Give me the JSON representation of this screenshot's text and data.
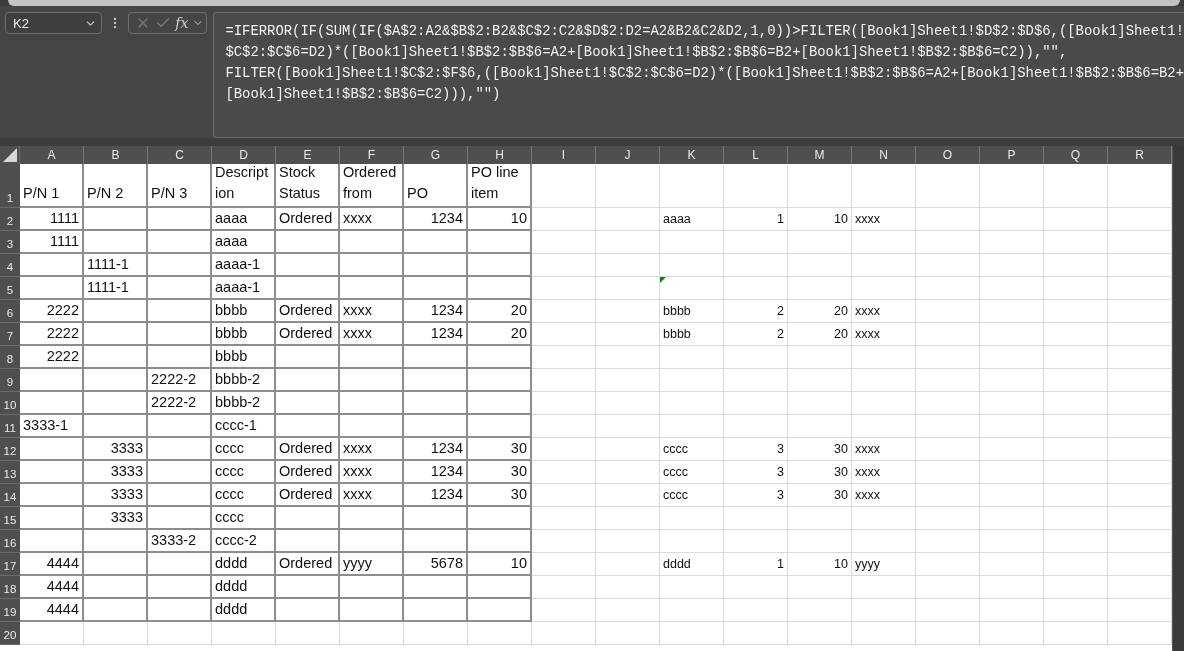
{
  "formula_bar": {
    "name_box": "K2",
    "function_label": "fx",
    "formula_lines": [
      "=IFERROR(IF(SUM(IF($A$2:A2&$B$2:B2&$C$2:C2&$D$2:D2=A2&B2&C2&D2,1,0))>FILTER([Book1]Sheet1!$D$2:$D$6,([Book1]Sheet1!",
      "$C$2:$C$6=D2)*([Book1]Sheet1!$B$2:$B$6=A2+[Book1]Sheet1!$B$2:$B$6=B2+[Book1]Sheet1!$B$2:$B$6=C2)),\"\",",
      "FILTER([Book1]Sheet1!$C$2:$F$6,([Book1]Sheet1!$C$2:$C$6=D2)*([Book1]Sheet1!$B$2:$B$6=A2+[Book1]Sheet1!$B$2:$B$6=B2+",
      "[Book1]Sheet1!$B$2:$B$6=C2))),\"\")"
    ]
  },
  "columns": [
    {
      "letter": "A",
      "bordered": true
    },
    {
      "letter": "B",
      "bordered": true
    },
    {
      "letter": "C",
      "bordered": true
    },
    {
      "letter": "D",
      "bordered": true
    },
    {
      "letter": "E",
      "bordered": true
    },
    {
      "letter": "F",
      "bordered": true
    },
    {
      "letter": "G",
      "bordered": true
    },
    {
      "letter": "H",
      "bordered": true
    },
    {
      "letter": "I",
      "bordered": false
    },
    {
      "letter": "J",
      "bordered": false
    },
    {
      "letter": "K",
      "bordered": false
    },
    {
      "letter": "L",
      "bordered": false
    },
    {
      "letter": "M",
      "bordered": false
    },
    {
      "letter": "N",
      "bordered": false
    },
    {
      "letter": "O",
      "bordered": false
    },
    {
      "letter": "P",
      "bordered": false
    },
    {
      "letter": "Q",
      "bordered": false
    },
    {
      "letter": "R",
      "bordered": false
    }
  ],
  "rows": [
    {
      "number": "1",
      "bordered": true,
      "cells": {
        "A": {
          "text": "P/N 1",
          "kind": "text"
        },
        "B": {
          "text": "P/N 2",
          "kind": "text"
        },
        "C": {
          "text": "P/N 3",
          "kind": "text"
        },
        "D": {
          "text": "Description",
          "kind": "text"
        },
        "E": {
          "text": "Stock Status",
          "kind": "text"
        },
        "F": {
          "text": "Ordered from",
          "kind": "text"
        },
        "G": {
          "text": "PO",
          "kind": "text"
        },
        "H": {
          "text": "PO line item",
          "kind": "text"
        }
      }
    },
    {
      "number": "2",
      "bordered": true,
      "cells": {
        "A": {
          "text": "1111",
          "kind": "number"
        },
        "D": {
          "text": "aaaa",
          "kind": "text"
        },
        "E": {
          "text": "Ordered",
          "kind": "text"
        },
        "F": {
          "text": "xxxx",
          "kind": "text"
        },
        "G": {
          "text": "1234",
          "kind": "number"
        },
        "H": {
          "text": "10",
          "kind": "number"
        },
        "K": {
          "text": "aaaa",
          "kind": "text"
        },
        "L": {
          "text": "1",
          "kind": "number"
        },
        "M": {
          "text": "10",
          "kind": "number"
        },
        "N": {
          "text": "xxxx",
          "kind": "text"
        }
      }
    },
    {
      "number": "3",
      "bordered": true,
      "cells": {
        "A": {
          "text": "1111",
          "kind": "number"
        },
        "D": {
          "text": "aaaa",
          "kind": "text"
        }
      }
    },
    {
      "number": "4",
      "bordered": true,
      "cells": {
        "B": {
          "text": "1111-1",
          "kind": "text"
        },
        "D": {
          "text": "aaaa-1",
          "kind": "text"
        }
      }
    },
    {
      "number": "5",
      "bordered": true,
      "cells": {
        "B": {
          "text": "1111-1",
          "kind": "text"
        },
        "D": {
          "text": "aaaa-1",
          "kind": "text"
        },
        "K": {
          "error_flag": true
        }
      }
    },
    {
      "number": "6",
      "bordered": true,
      "cells": {
        "A": {
          "text": "2222",
          "kind": "number"
        },
        "D": {
          "text": "bbbb",
          "kind": "text"
        },
        "E": {
          "text": "Ordered",
          "kind": "text"
        },
        "F": {
          "text": "xxxx",
          "kind": "text"
        },
        "G": {
          "text": "1234",
          "kind": "number"
        },
        "H": {
          "text": "20",
          "kind": "number"
        },
        "K": {
          "text": "bbbb",
          "kind": "text"
        },
        "L": {
          "text": "2",
          "kind": "number"
        },
        "M": {
          "text": "20",
          "kind": "number"
        },
        "N": {
          "text": "xxxx",
          "kind": "text"
        }
      }
    },
    {
      "number": "7",
      "bordered": true,
      "cells": {
        "A": {
          "text": "2222",
          "kind": "number"
        },
        "D": {
          "text": "bbbb",
          "kind": "text"
        },
        "E": {
          "text": "Ordered",
          "kind": "text"
        },
        "F": {
          "text": "xxxx",
          "kind": "text"
        },
        "G": {
          "text": "1234",
          "kind": "number"
        },
        "H": {
          "text": "20",
          "kind": "number"
        },
        "K": {
          "text": "bbbb",
          "kind": "text"
        },
        "L": {
          "text": "2",
          "kind": "number"
        },
        "M": {
          "text": "20",
          "kind": "number"
        },
        "N": {
          "text": "xxxx",
          "kind": "text"
        }
      }
    },
    {
      "number": "8",
      "bordered": true,
      "cells": {
        "A": {
          "text": "2222",
          "kind": "number"
        },
        "D": {
          "text": "bbbb",
          "kind": "text"
        }
      }
    },
    {
      "number": "9",
      "bordered": true,
      "cells": {
        "C": {
          "text": "2222-2",
          "kind": "text"
        },
        "D": {
          "text": "bbbb-2",
          "kind": "text"
        }
      }
    },
    {
      "number": "10",
      "bordered": true,
      "cells": {
        "C": {
          "text": "2222-2",
          "kind": "text"
        },
        "D": {
          "text": "bbbb-2",
          "kind": "text"
        }
      }
    },
    {
      "number": "11",
      "bordered": true,
      "cells": {
        "A": {
          "text": "3333-1",
          "kind": "text"
        },
        "D": {
          "text": "cccc-1",
          "kind": "text"
        }
      }
    },
    {
      "number": "12",
      "bordered": true,
      "cells": {
        "B": {
          "text": "3333",
          "kind": "number"
        },
        "D": {
          "text": "cccc",
          "kind": "text"
        },
        "E": {
          "text": "Ordered",
          "kind": "text"
        },
        "F": {
          "text": "xxxx",
          "kind": "text"
        },
        "G": {
          "text": "1234",
          "kind": "number"
        },
        "H": {
          "text": "30",
          "kind": "number"
        },
        "K": {
          "text": "cccc",
          "kind": "text"
        },
        "L": {
          "text": "3",
          "kind": "number"
        },
        "M": {
          "text": "30",
          "kind": "number"
        },
        "N": {
          "text": "xxxx",
          "kind": "text"
        }
      }
    },
    {
      "number": "13",
      "bordered": true,
      "cells": {
        "B": {
          "text": "3333",
          "kind": "number"
        },
        "D": {
          "text": "cccc",
          "kind": "text"
        },
        "E": {
          "text": "Ordered",
          "kind": "text"
        },
        "F": {
          "text": "xxxx",
          "kind": "text"
        },
        "G": {
          "text": "1234",
          "kind": "number"
        },
        "H": {
          "text": "30",
          "kind": "number"
        },
        "K": {
          "text": "cccc",
          "kind": "text"
        },
        "L": {
          "text": "3",
          "kind": "number"
        },
        "M": {
          "text": "30",
          "kind": "number"
        },
        "N": {
          "text": "xxxx",
          "kind": "text"
        }
      }
    },
    {
      "number": "14",
      "bordered": true,
      "cells": {
        "B": {
          "text": "3333",
          "kind": "number"
        },
        "D": {
          "text": "cccc",
          "kind": "text"
        },
        "E": {
          "text": "Ordered",
          "kind": "text"
        },
        "F": {
          "text": "xxxx",
          "kind": "text"
        },
        "G": {
          "text": "1234",
          "kind": "number"
        },
        "H": {
          "text": "30",
          "kind": "number"
        },
        "K": {
          "text": "cccc",
          "kind": "text"
        },
        "L": {
          "text": "3",
          "kind": "number"
        },
        "M": {
          "text": "30",
          "kind": "number"
        },
        "N": {
          "text": "xxxx",
          "kind": "text"
        }
      }
    },
    {
      "number": "15",
      "bordered": true,
      "cells": {
        "B": {
          "text": "3333",
          "kind": "number"
        },
        "D": {
          "text": "cccc",
          "kind": "text"
        }
      }
    },
    {
      "number": "16",
      "bordered": true,
      "cells": {
        "C": {
          "text": "3333-2",
          "kind": "text"
        },
        "D": {
          "text": "cccc-2",
          "kind": "text"
        }
      }
    },
    {
      "number": "17",
      "bordered": true,
      "cells": {
        "A": {
          "text": "4444",
          "kind": "number"
        },
        "D": {
          "text": "dddd",
          "kind": "text"
        },
        "E": {
          "text": "Ordered",
          "kind": "text"
        },
        "F": {
          "text": "yyyy",
          "kind": "text"
        },
        "G": {
          "text": "5678",
          "kind": "number"
        },
        "H": {
          "text": "10",
          "kind": "number"
        },
        "K": {
          "text": "dddd",
          "kind": "text"
        },
        "L": {
          "text": "1",
          "kind": "number"
        },
        "M": {
          "text": "10",
          "kind": "number"
        },
        "N": {
          "text": "yyyy",
          "kind": "text"
        }
      }
    },
    {
      "number": "18",
      "bordered": true,
      "cells": {
        "A": {
          "text": "4444",
          "kind": "number"
        },
        "D": {
          "text": "dddd",
          "kind": "text"
        }
      }
    },
    {
      "number": "19",
      "bordered": true,
      "cells": {
        "A": {
          "text": "4444",
          "kind": "number"
        },
        "D": {
          "text": "dddd",
          "kind": "text"
        }
      }
    },
    {
      "number": "20",
      "cells": {}
    }
  ]
}
